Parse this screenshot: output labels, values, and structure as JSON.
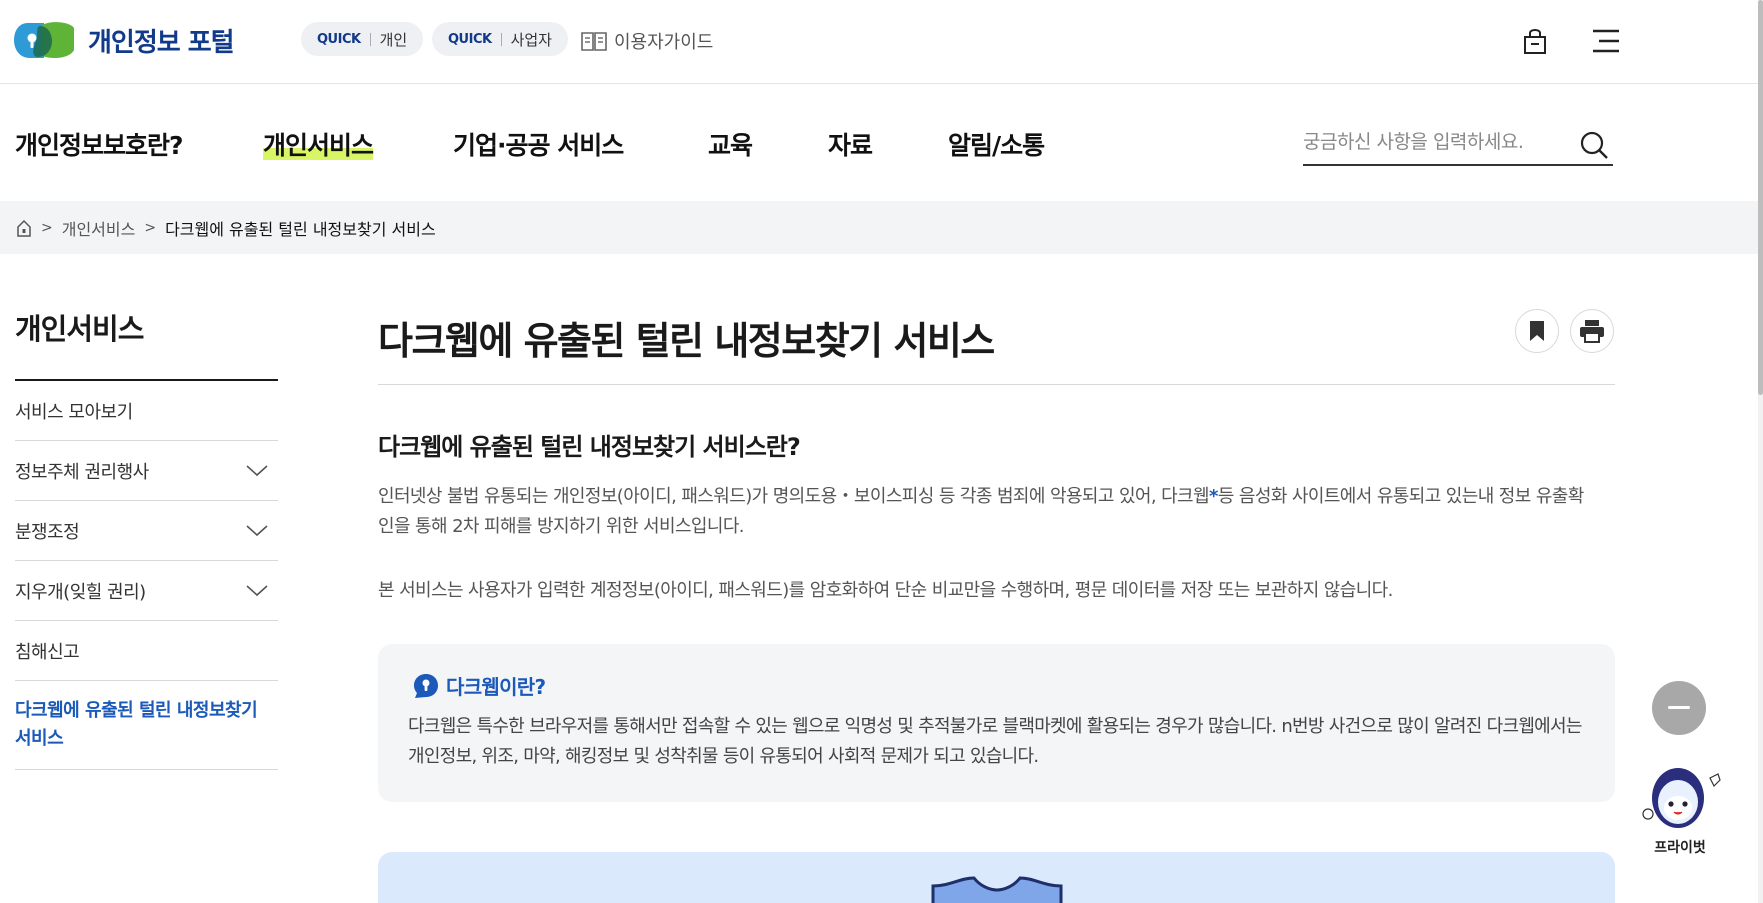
{
  "header": {
    "logo_text": "개인정보 포털",
    "quick_personal": {
      "tag": "QUICK",
      "label": "개인"
    },
    "quick_business": {
      "tag": "QUICK",
      "label": "사업자"
    },
    "guide_label": "이용자가이드",
    "icons": [
      "lock-icon",
      "menu-icon"
    ]
  },
  "gnb": {
    "items": [
      "개인정보보호란?",
      "개인서비스",
      "기업·공공 서비스",
      "교육",
      "자료",
      "알림/소통"
    ],
    "active_index": 1,
    "search_placeholder": "궁금하신 사항을 입력하세요."
  },
  "breadcrumb": {
    "items": [
      "개인서비스",
      "다크웹에 유출된 털린 내정보찾기 서비스"
    ]
  },
  "sidebar": {
    "title": "개인서비스",
    "items": [
      {
        "label": "서비스 모아보기",
        "expandable": false
      },
      {
        "label": "정보주체 권리행사",
        "expandable": true
      },
      {
        "label": "분쟁조정",
        "expandable": true
      },
      {
        "label": "지우개(잊힐 권리)",
        "expandable": true
      },
      {
        "label": "침해신고",
        "expandable": false
      },
      {
        "label": "다크웹에 유출된 털린 내정보찾기 서비스",
        "expandable": false,
        "active": true
      }
    ]
  },
  "main": {
    "title": "다크웹에 유출된 털린 내정보찾기 서비스",
    "section_title": "다크웹에 유출된 털린 내정보찾기 서비스란?",
    "para1_a": "인터넷상 불법 유통되는 개인정보(아이디, 패스워드)가 명의도용・보이스피싱 등 각종 범죄에 악용되고 있어, 다크웹",
    "para1_star": "*",
    "para1_b": "등 음성화 사이트에서 유통되고 있는내 정보 유출확인을 통해 2차 피해를 방지하기 위한 서비스입니다.",
    "para2": "본 서비스는 사용자가 입력한 계정정보(아이디, 패스워드)를 암호화하여 단순 비교만을 수행하며, 평문 데이터를 저장 또는 보관하지 않습니다.",
    "info_title": "다크웹이란?",
    "info_text": "다크웹은 특수한 브라우저를 통해서만 접속할 수 있는 웹으로 익명성 및 추적불가로 블랙마켓에 활용되는 경우가 많습니다. n번방 사건으로 많이 알려진 다크웹에서는 개인정보, 위조, 마약, 해킹정보 및 성착취물 등이 유통되어 사회적 문제가 되고 있습니다."
  },
  "floating": {
    "chatbot_label": "프라이벗"
  },
  "colors": {
    "brand_navy": "#123a8a",
    "accent_blue": "#1b5ab8",
    "highlight_green": "#d8f566"
  }
}
